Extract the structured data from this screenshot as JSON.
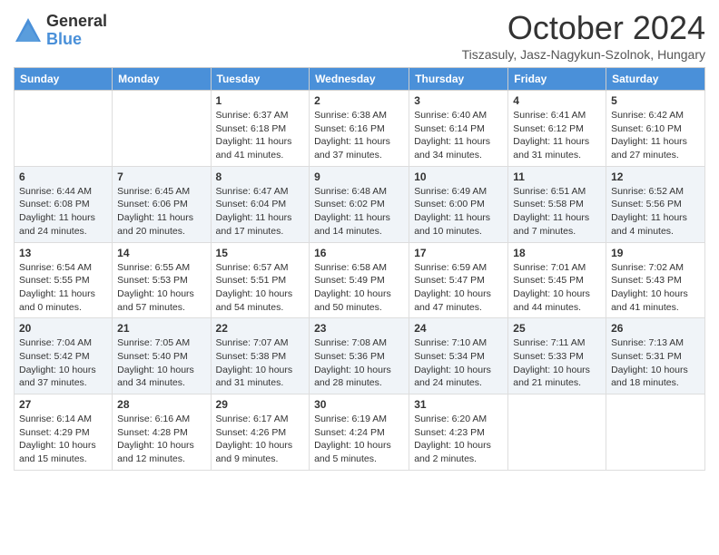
{
  "logo": {
    "general": "General",
    "blue": "Blue"
  },
  "header": {
    "month": "October 2024",
    "subtitle": "Tiszasuly, Jasz-Nagykun-Szolnok, Hungary"
  },
  "weekdays": [
    "Sunday",
    "Monday",
    "Tuesday",
    "Wednesday",
    "Thursday",
    "Friday",
    "Saturday"
  ],
  "weeks": [
    [
      {
        "day": "",
        "info": ""
      },
      {
        "day": "",
        "info": ""
      },
      {
        "day": "1",
        "info": "Sunrise: 6:37 AM\nSunset: 6:18 PM\nDaylight: 11 hours and 41 minutes."
      },
      {
        "day": "2",
        "info": "Sunrise: 6:38 AM\nSunset: 6:16 PM\nDaylight: 11 hours and 37 minutes."
      },
      {
        "day": "3",
        "info": "Sunrise: 6:40 AM\nSunset: 6:14 PM\nDaylight: 11 hours and 34 minutes."
      },
      {
        "day": "4",
        "info": "Sunrise: 6:41 AM\nSunset: 6:12 PM\nDaylight: 11 hours and 31 minutes."
      },
      {
        "day": "5",
        "info": "Sunrise: 6:42 AM\nSunset: 6:10 PM\nDaylight: 11 hours and 27 minutes."
      }
    ],
    [
      {
        "day": "6",
        "info": "Sunrise: 6:44 AM\nSunset: 6:08 PM\nDaylight: 11 hours and 24 minutes."
      },
      {
        "day": "7",
        "info": "Sunrise: 6:45 AM\nSunset: 6:06 PM\nDaylight: 11 hours and 20 minutes."
      },
      {
        "day": "8",
        "info": "Sunrise: 6:47 AM\nSunset: 6:04 PM\nDaylight: 11 hours and 17 minutes."
      },
      {
        "day": "9",
        "info": "Sunrise: 6:48 AM\nSunset: 6:02 PM\nDaylight: 11 hours and 14 minutes."
      },
      {
        "day": "10",
        "info": "Sunrise: 6:49 AM\nSunset: 6:00 PM\nDaylight: 11 hours and 10 minutes."
      },
      {
        "day": "11",
        "info": "Sunrise: 6:51 AM\nSunset: 5:58 PM\nDaylight: 11 hours and 7 minutes."
      },
      {
        "day": "12",
        "info": "Sunrise: 6:52 AM\nSunset: 5:56 PM\nDaylight: 11 hours and 4 minutes."
      }
    ],
    [
      {
        "day": "13",
        "info": "Sunrise: 6:54 AM\nSunset: 5:55 PM\nDaylight: 11 hours and 0 minutes."
      },
      {
        "day": "14",
        "info": "Sunrise: 6:55 AM\nSunset: 5:53 PM\nDaylight: 10 hours and 57 minutes."
      },
      {
        "day": "15",
        "info": "Sunrise: 6:57 AM\nSunset: 5:51 PM\nDaylight: 10 hours and 54 minutes."
      },
      {
        "day": "16",
        "info": "Sunrise: 6:58 AM\nSunset: 5:49 PM\nDaylight: 10 hours and 50 minutes."
      },
      {
        "day": "17",
        "info": "Sunrise: 6:59 AM\nSunset: 5:47 PM\nDaylight: 10 hours and 47 minutes."
      },
      {
        "day": "18",
        "info": "Sunrise: 7:01 AM\nSunset: 5:45 PM\nDaylight: 10 hours and 44 minutes."
      },
      {
        "day": "19",
        "info": "Sunrise: 7:02 AM\nSunset: 5:43 PM\nDaylight: 10 hours and 41 minutes."
      }
    ],
    [
      {
        "day": "20",
        "info": "Sunrise: 7:04 AM\nSunset: 5:42 PM\nDaylight: 10 hours and 37 minutes."
      },
      {
        "day": "21",
        "info": "Sunrise: 7:05 AM\nSunset: 5:40 PM\nDaylight: 10 hours and 34 minutes."
      },
      {
        "day": "22",
        "info": "Sunrise: 7:07 AM\nSunset: 5:38 PM\nDaylight: 10 hours and 31 minutes."
      },
      {
        "day": "23",
        "info": "Sunrise: 7:08 AM\nSunset: 5:36 PM\nDaylight: 10 hours and 28 minutes."
      },
      {
        "day": "24",
        "info": "Sunrise: 7:10 AM\nSunset: 5:34 PM\nDaylight: 10 hours and 24 minutes."
      },
      {
        "day": "25",
        "info": "Sunrise: 7:11 AM\nSunset: 5:33 PM\nDaylight: 10 hours and 21 minutes."
      },
      {
        "day": "26",
        "info": "Sunrise: 7:13 AM\nSunset: 5:31 PM\nDaylight: 10 hours and 18 minutes."
      }
    ],
    [
      {
        "day": "27",
        "info": "Sunrise: 6:14 AM\nSunset: 4:29 PM\nDaylight: 10 hours and 15 minutes."
      },
      {
        "day": "28",
        "info": "Sunrise: 6:16 AM\nSunset: 4:28 PM\nDaylight: 10 hours and 12 minutes."
      },
      {
        "day": "29",
        "info": "Sunrise: 6:17 AM\nSunset: 4:26 PM\nDaylight: 10 hours and 9 minutes."
      },
      {
        "day": "30",
        "info": "Sunrise: 6:19 AM\nSunset: 4:24 PM\nDaylight: 10 hours and 5 minutes."
      },
      {
        "day": "31",
        "info": "Sunrise: 6:20 AM\nSunset: 4:23 PM\nDaylight: 10 hours and 2 minutes."
      },
      {
        "day": "",
        "info": ""
      },
      {
        "day": "",
        "info": ""
      }
    ]
  ]
}
